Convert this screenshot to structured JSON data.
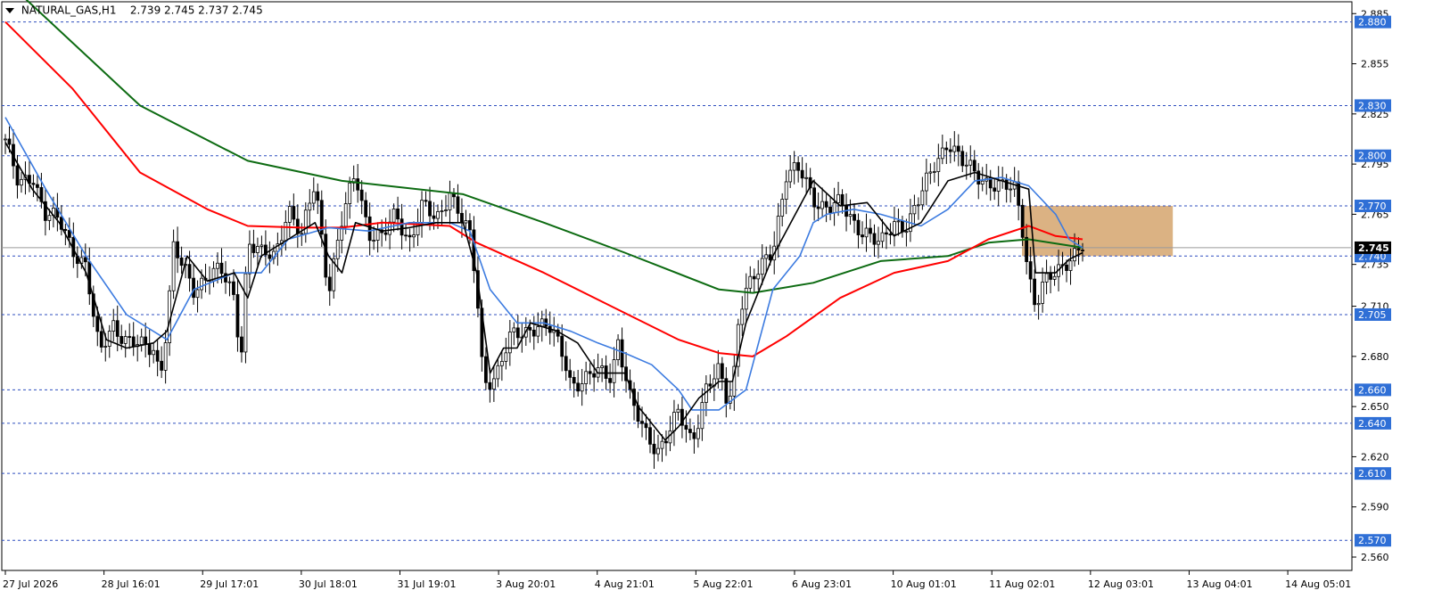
{
  "header": {
    "symbol": "NATURAL_GAS,H1",
    "ohlc": "2.739 2.745 2.737 2.745"
  },
  "chart_data": {
    "type": "candlestick",
    "ylim": [
      2.552,
      2.891
    ],
    "y_ticks": [
      2.885,
      2.855,
      2.825,
      2.795,
      2.765,
      2.735,
      2.71,
      2.68,
      2.65,
      2.62,
      2.59,
      2.56
    ],
    "y_tick_labels": [
      "2.885",
      "2.855",
      "2.825",
      "2.795",
      "2.765",
      "2.735",
      "2.710",
      "2.680",
      "2.650",
      "2.620",
      "2.590",
      "2.560"
    ],
    "x_tick_labels": [
      "27 Jul 2026",
      "28 Jul 16:01",
      "29 Jul 17:01",
      "30 Jul 18:01",
      "31 Jul 19:01",
      "3 Aug 20:01",
      "4 Aug 21:01",
      "5 Aug 22:01",
      "6 Aug 23:01",
      "10 Aug 01:01",
      "11 Aug 02:01",
      "12 Aug 03:01",
      "13 Aug 04:01",
      "14 Aug 05:01"
    ],
    "levels": [
      {
        "value": 2.88,
        "label": "2.880"
      },
      {
        "value": 2.83,
        "label": "2.830"
      },
      {
        "value": 2.8,
        "label": "2.800"
      },
      {
        "value": 2.77,
        "label": "2.770"
      },
      {
        "value": 2.74,
        "label": "2.740"
      },
      {
        "value": 2.705,
        "label": "2.705"
      },
      {
        "value": 2.66,
        "label": "2.660"
      },
      {
        "value": 2.64,
        "label": "2.640"
      },
      {
        "value": 2.61,
        "label": "2.610"
      },
      {
        "value": 2.57,
        "label": "2.570"
      }
    ],
    "current_price": {
      "value": 2.745,
      "label": "2.745"
    },
    "zone": {
      "x_from": 0.755,
      "x_to": 0.867,
      "y_low": 2.74,
      "y_high": 2.77,
      "color": "#d9ae7c"
    },
    "colors": {
      "ma_black": "#000000",
      "ma_blue": "#3c7be0",
      "ma_red": "#ff0000",
      "ma_green": "#0d6b12",
      "level_line": "#2f4fbf",
      "label_bg": "#2f6fd6",
      "price_bg": "#000000"
    },
    "series": [
      {
        "key": "ma_green",
        "points": [
          [
            0.0,
            2.905
          ],
          [
            0.1,
            2.83
          ],
          [
            0.18,
            2.797
          ],
          [
            0.25,
            2.785
          ],
          [
            0.34,
            2.777
          ],
          [
            0.4,
            2.76
          ],
          [
            0.46,
            2.742
          ],
          [
            0.53,
            2.72
          ],
          [
            0.555,
            2.718
          ],
          [
            0.6,
            2.724
          ],
          [
            0.65,
            2.737
          ],
          [
            0.7,
            2.74
          ],
          [
            0.73,
            2.748
          ],
          [
            0.76,
            2.75
          ],
          [
            0.8,
            2.745
          ]
        ]
      },
      {
        "key": "ma_red",
        "points": [
          [
            0.0,
            2.88
          ],
          [
            0.05,
            2.84
          ],
          [
            0.1,
            2.79
          ],
          [
            0.15,
            2.768
          ],
          [
            0.18,
            2.758
          ],
          [
            0.22,
            2.757
          ],
          [
            0.25,
            2.757
          ],
          [
            0.28,
            2.76
          ],
          [
            0.33,
            2.758
          ],
          [
            0.35,
            2.748
          ],
          [
            0.4,
            2.73
          ],
          [
            0.45,
            2.71
          ],
          [
            0.5,
            2.69
          ],
          [
            0.53,
            2.682
          ],
          [
            0.555,
            2.68
          ],
          [
            0.58,
            2.692
          ],
          [
            0.62,
            2.715
          ],
          [
            0.66,
            2.73
          ],
          [
            0.7,
            2.737
          ],
          [
            0.73,
            2.75
          ],
          [
            0.76,
            2.758
          ],
          [
            0.78,
            2.752
          ],
          [
            0.8,
            2.75
          ]
        ]
      },
      {
        "key": "ma_blue",
        "points": [
          [
            0.0,
            2.823
          ],
          [
            0.03,
            2.78
          ],
          [
            0.06,
            2.74
          ],
          [
            0.09,
            2.705
          ],
          [
            0.12,
            2.69
          ],
          [
            0.14,
            2.72
          ],
          [
            0.17,
            2.73
          ],
          [
            0.19,
            2.73
          ],
          [
            0.21,
            2.75
          ],
          [
            0.24,
            2.757
          ],
          [
            0.27,
            2.755
          ],
          [
            0.3,
            2.76
          ],
          [
            0.33,
            2.76
          ],
          [
            0.345,
            2.755
          ],
          [
            0.36,
            2.72
          ],
          [
            0.38,
            2.7
          ],
          [
            0.4,
            2.7
          ],
          [
            0.42,
            2.695
          ],
          [
            0.44,
            2.688
          ],
          [
            0.46,
            2.682
          ],
          [
            0.48,
            2.675
          ],
          [
            0.5,
            2.66
          ],
          [
            0.51,
            2.648
          ],
          [
            0.53,
            2.648
          ],
          [
            0.55,
            2.66
          ],
          [
            0.57,
            2.72
          ],
          [
            0.59,
            2.74
          ],
          [
            0.6,
            2.76
          ],
          [
            0.61,
            2.765
          ],
          [
            0.63,
            2.768
          ],
          [
            0.65,
            2.765
          ],
          [
            0.68,
            2.758
          ],
          [
            0.7,
            2.768
          ],
          [
            0.72,
            2.785
          ],
          [
            0.74,
            2.787
          ],
          [
            0.76,
            2.782
          ],
          [
            0.78,
            2.765
          ],
          [
            0.79,
            2.75
          ],
          [
            0.8,
            2.745
          ]
        ]
      },
      {
        "key": "ma_black",
        "points": [
          [
            0.0,
            2.808
          ],
          [
            0.02,
            2.78
          ],
          [
            0.04,
            2.76
          ],
          [
            0.06,
            2.73
          ],
          [
            0.075,
            2.69
          ],
          [
            0.09,
            2.685
          ],
          [
            0.11,
            2.688
          ],
          [
            0.12,
            2.695
          ],
          [
            0.135,
            2.74
          ],
          [
            0.15,
            2.725
          ],
          [
            0.17,
            2.73
          ],
          [
            0.18,
            2.715
          ],
          [
            0.19,
            2.74
          ],
          [
            0.21,
            2.75
          ],
          [
            0.23,
            2.76
          ],
          [
            0.24,
            2.74
          ],
          [
            0.25,
            2.73
          ],
          [
            0.26,
            2.76
          ],
          [
            0.28,
            2.755
          ],
          [
            0.3,
            2.757
          ],
          [
            0.32,
            2.76
          ],
          [
            0.34,
            2.76
          ],
          [
            0.35,
            2.73
          ],
          [
            0.36,
            2.67
          ],
          [
            0.37,
            2.685
          ],
          [
            0.38,
            2.685
          ],
          [
            0.39,
            2.7
          ],
          [
            0.41,
            2.695
          ],
          [
            0.425,
            2.688
          ],
          [
            0.44,
            2.67
          ],
          [
            0.46,
            2.67
          ],
          [
            0.47,
            2.65
          ],
          [
            0.49,
            2.63
          ],
          [
            0.5,
            2.638
          ],
          [
            0.515,
            2.655
          ],
          [
            0.53,
            2.665
          ],
          [
            0.54,
            2.665
          ],
          [
            0.55,
            2.7
          ],
          [
            0.57,
            2.74
          ],
          [
            0.59,
            2.77
          ],
          [
            0.6,
            2.785
          ],
          [
            0.62,
            2.77
          ],
          [
            0.64,
            2.772
          ],
          [
            0.66,
            2.752
          ],
          [
            0.68,
            2.76
          ],
          [
            0.7,
            2.785
          ],
          [
            0.72,
            2.79
          ],
          [
            0.74,
            2.785
          ],
          [
            0.76,
            2.78
          ],
          [
            0.765,
            2.73
          ],
          [
            0.78,
            2.73
          ],
          [
            0.79,
            2.738
          ],
          [
            0.8,
            2.742
          ]
        ]
      },
      {
        "key": "price",
        "points": [
          [
            0.0,
            2.81
          ],
          [
            0.01,
            2.78
          ],
          [
            0.02,
            2.79
          ],
          [
            0.03,
            2.765
          ],
          [
            0.04,
            2.76
          ],
          [
            0.05,
            2.745
          ],
          [
            0.06,
            2.735
          ],
          [
            0.065,
            2.705
          ],
          [
            0.07,
            2.68
          ],
          [
            0.08,
            2.7
          ],
          [
            0.09,
            2.69
          ],
          [
            0.1,
            2.685
          ],
          [
            0.11,
            2.685
          ],
          [
            0.115,
            2.67
          ],
          [
            0.12,
            2.7
          ],
          [
            0.125,
            2.745
          ],
          [
            0.13,
            2.735
          ],
          [
            0.14,
            2.72
          ],
          [
            0.15,
            2.73
          ],
          [
            0.16,
            2.73
          ],
          [
            0.17,
            2.715
          ],
          [
            0.175,
            2.68
          ],
          [
            0.18,
            2.75
          ],
          [
            0.19,
            2.74
          ],
          [
            0.2,
            2.74
          ],
          [
            0.21,
            2.77
          ],
          [
            0.22,
            2.75
          ],
          [
            0.23,
            2.785
          ],
          [
            0.24,
            2.72
          ],
          [
            0.25,
            2.76
          ],
          [
            0.26,
            2.79
          ],
          [
            0.27,
            2.755
          ],
          [
            0.28,
            2.75
          ],
          [
            0.29,
            2.765
          ],
          [
            0.3,
            2.75
          ],
          [
            0.31,
            2.77
          ],
          [
            0.32,
            2.76
          ],
          [
            0.33,
            2.78
          ],
          [
            0.34,
            2.76
          ],
          [
            0.345,
            2.75
          ],
          [
            0.35,
            2.72
          ],
          [
            0.355,
            2.665
          ],
          [
            0.365,
            2.67
          ],
          [
            0.375,
            2.69
          ],
          [
            0.385,
            2.695
          ],
          [
            0.395,
            2.7
          ],
          [
            0.405,
            2.695
          ],
          [
            0.415,
            2.68
          ],
          [
            0.42,
            2.665
          ],
          [
            0.43,
            2.665
          ],
          [
            0.44,
            2.67
          ],
          [
            0.45,
            2.67
          ],
          [
            0.455,
            2.69
          ],
          [
            0.465,
            2.65
          ],
          [
            0.475,
            2.635
          ],
          [
            0.485,
            2.625
          ],
          [
            0.49,
            2.63
          ],
          [
            0.5,
            2.645
          ],
          [
            0.51,
            2.63
          ],
          [
            0.52,
            2.66
          ],
          [
            0.53,
            2.67
          ],
          [
            0.535,
            2.655
          ],
          [
            0.54,
            2.66
          ],
          [
            0.545,
            2.71
          ],
          [
            0.55,
            2.72
          ],
          [
            0.56,
            2.73
          ],
          [
            0.57,
            2.745
          ],
          [
            0.58,
            2.79
          ],
          [
            0.59,
            2.79
          ],
          [
            0.6,
            2.775
          ],
          [
            0.61,
            2.77
          ],
          [
            0.62,
            2.77
          ],
          [
            0.63,
            2.76
          ],
          [
            0.64,
            2.755
          ],
          [
            0.65,
            2.745
          ],
          [
            0.66,
            2.76
          ],
          [
            0.67,
            2.76
          ],
          [
            0.68,
            2.775
          ],
          [
            0.69,
            2.795
          ],
          [
            0.7,
            2.81
          ],
          [
            0.71,
            2.795
          ],
          [
            0.72,
            2.79
          ],
          [
            0.73,
            2.785
          ],
          [
            0.74,
            2.78
          ],
          [
            0.75,
            2.78
          ],
          [
            0.755,
            2.76
          ],
          [
            0.76,
            2.73
          ],
          [
            0.765,
            2.71
          ],
          [
            0.77,
            2.72
          ],
          [
            0.78,
            2.73
          ],
          [
            0.79,
            2.74
          ],
          [
            0.8,
            2.745
          ]
        ]
      }
    ]
  }
}
